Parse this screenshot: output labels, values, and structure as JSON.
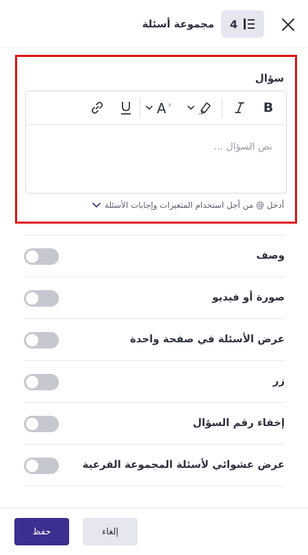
{
  "header": {
    "title": "مجموعة أسئلة",
    "question_count": "4",
    "close_icon": "close-icon",
    "type_icon": "question-group-icon"
  },
  "question": {
    "label": "سؤال",
    "placeholder": "نص السؤال ...",
    "toolbar": [
      {
        "name": "bold-button",
        "icon": "bold-icon",
        "glyph": "B"
      },
      {
        "name": "italic-button",
        "icon": "italic-icon",
        "glyph": "I"
      },
      {
        "name": "highlight-button",
        "icon": "highlight-icon"
      },
      {
        "name": "font-size-button",
        "icon": "font-size-icon",
        "glyph": "A"
      },
      {
        "name": "underline-button",
        "icon": "underline-icon",
        "glyph": "U"
      },
      {
        "name": "link-button",
        "icon": "link-icon"
      }
    ],
    "hint": "أدخل @ من أجل استخدام المتغيرات وإجابات الأسئلة"
  },
  "options": [
    {
      "label": "وصف",
      "enabled": false
    },
    {
      "label": "صورة أو فيديو",
      "enabled": false
    },
    {
      "label": "عرض الأسئلة في صفحة واحدة",
      "enabled": false
    },
    {
      "label": "زر",
      "enabled": false
    },
    {
      "label": "إخفاء رقم السؤال",
      "enabled": false
    },
    {
      "label": "عرض عشوائي لأسئلة المجموعة الفرعية",
      "enabled": false
    }
  ],
  "footer": {
    "save_label": "حفظ",
    "cancel_label": "إلغاء"
  },
  "colors": {
    "primary": "#3b2f8f",
    "highlight_border": "#e01010",
    "toggle_off": "#c6c7cf"
  }
}
